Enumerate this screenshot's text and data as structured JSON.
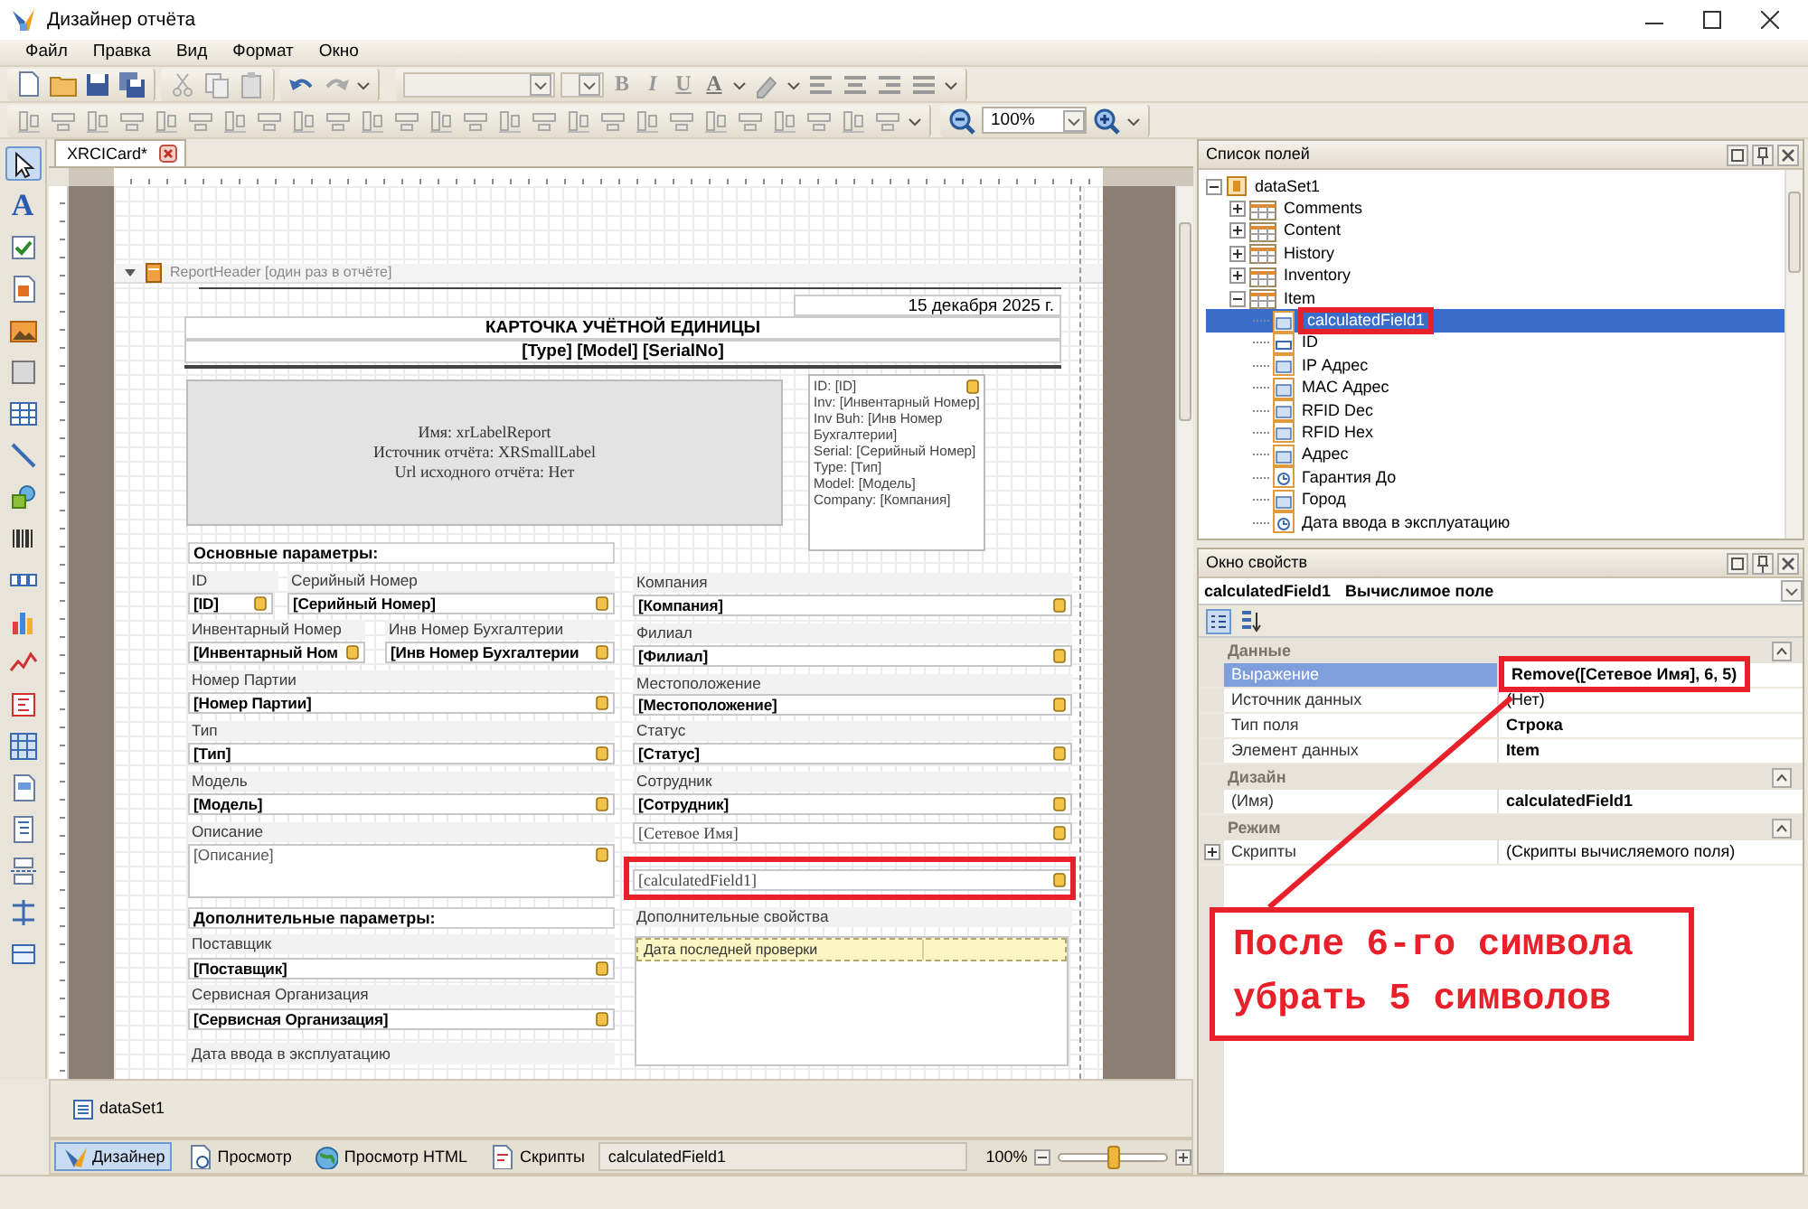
{
  "window": {
    "title": "Дизайнер отчёта"
  },
  "menu": [
    "Файл",
    "Правка",
    "Вид",
    "Формат",
    "Окно"
  ],
  "format_buttons": [
    "B",
    "I",
    "U",
    "A"
  ],
  "zoom_field": "100%",
  "toolbox": [
    {
      "kind": "pointer",
      "selected": true
    },
    {
      "kind": "label",
      "text": "A",
      "selected": false
    },
    {
      "kind": "checkbox",
      "selected": false
    },
    {
      "kind": "richtext",
      "selected": false
    },
    {
      "kind": "picture",
      "selected": false
    },
    {
      "kind": "panel",
      "selected": false
    },
    {
      "kind": "table",
      "selected": false
    },
    {
      "kind": "line",
      "selected": false
    },
    {
      "kind": "shape",
      "selected": false
    },
    {
      "kind": "barcode",
      "selected": false
    },
    {
      "kind": "zipcode",
      "selected": false
    },
    {
      "kind": "chart",
      "selected": false
    },
    {
      "kind": "sparkline",
      "selected": false
    },
    {
      "kind": "summary",
      "selected": false
    },
    {
      "kind": "pivot",
      "selected": false
    },
    {
      "kind": "subreport",
      "selected": false
    },
    {
      "kind": "contents",
      "selected": false
    },
    {
      "kind": "pagebreak",
      "selected": false
    },
    {
      "kind": "crossband",
      "selected": false
    },
    {
      "kind": "crossbox",
      "selected": false
    }
  ],
  "document_tab": {
    "label": "XRCICard*",
    "selected": true
  },
  "band": {
    "label": "ReportHeader [один раз в отчёте]",
    "expanded": true
  },
  "report": {
    "date": "15 декабря 2025 г.",
    "title": "КАРТОЧКА УЧЁТНОЙ ЕДИНИЦЫ",
    "subtitle": "[Type] [Model] [SerialNo]",
    "subreport": [
      "Имя: xrLabelReport",
      "Источник отчёта: XRSmallLabel",
      "Url исходного отчёта: Нет"
    ],
    "info_lines": [
      "ID: [ID]",
      "Inv: [Инвентарный Номер]",
      "Inv Buh: [Инв Номер",
      "Бухгалтерии]",
      "Serial: [Серийный Номер]",
      "Type: [Тип]",
      "Model: [Модель]",
      "Company: [Компания]"
    ],
    "controls": [
      {
        "kind": "section",
        "text": "Основные параметры:"
      },
      {
        "kind": "caption",
        "text": "ID"
      },
      {
        "kind": "caption",
        "text": "Серийный Номер"
      },
      {
        "kind": "field",
        "text": "[ID]"
      },
      {
        "kind": "field",
        "text": "[Серийный Номер]"
      },
      {
        "kind": "caption",
        "text": "Инвентарный Номер"
      },
      {
        "kind": "caption",
        "text": "Инв Номер Бухгалтерии"
      },
      {
        "kind": "field",
        "text": "[Инвентарный Ном"
      },
      {
        "kind": "field",
        "text": "[Инв Номер Бухгалтерии"
      },
      {
        "kind": "caption",
        "text": "Номер Партии"
      },
      {
        "kind": "field",
        "text": "[Номер Партии]"
      },
      {
        "kind": "caption",
        "text": "Тип"
      },
      {
        "kind": "field",
        "text": "[Тип]"
      },
      {
        "kind": "caption",
        "text": "Модель"
      },
      {
        "kind": "field",
        "text": "[Модель]"
      },
      {
        "kind": "caption",
        "text": "Описание"
      },
      {
        "kind": "memo",
        "text": "[Описание]"
      },
      {
        "kind": "section",
        "text": "Дополнительные параметры:"
      },
      {
        "kind": "caption",
        "text": "Поставщик"
      },
      {
        "kind": "field",
        "text": "[Поставщик]"
      },
      {
        "kind": "caption",
        "text": "Сервисная Организация"
      },
      {
        "kind": "field",
        "text": "[Сервисная Организация]"
      },
      {
        "kind": "caption",
        "text": "Дата ввода в эксплуатацию"
      },
      {
        "kind": "caption",
        "text": "Компания"
      },
      {
        "kind": "field",
        "text": "[Компания]"
      },
      {
        "kind": "caption",
        "text": "Филиал"
      },
      {
        "kind": "field",
        "text": "[Филиал]"
      },
      {
        "kind": "caption",
        "text": "Местоположение"
      },
      {
        "kind": "field",
        "text": "[Местоположение]"
      },
      {
        "kind": "caption",
        "text": "Статус"
      },
      {
        "kind": "field",
        "text": "[Статус]"
      },
      {
        "kind": "caption",
        "text": "Сотрудник"
      },
      {
        "kind": "field",
        "text": "[Сотрудник]"
      },
      {
        "kind": "plain",
        "text": "[Сетевое Имя]"
      },
      {
        "kind": "plain",
        "text": "[calculatedField1]",
        "annotated": true
      },
      {
        "kind": "caption",
        "text": "Дополнительные свойства"
      },
      {
        "kind": "table",
        "text": "Дата последней проверки"
      }
    ]
  },
  "component_tray": [
    "dataSet1"
  ],
  "view_tabs": [
    {
      "label": "Дизайнер",
      "selected": true
    },
    {
      "label": "Просмотр",
      "selected": false
    },
    {
      "label": "Просмотр HTML",
      "selected": false
    },
    {
      "label": "Скрипты",
      "selected": false
    }
  ],
  "status_field": "calculatedField1",
  "zoom": {
    "reading": "100%",
    "level": 0.5
  },
  "field_list": {
    "title": "Список полей",
    "tree": [
      {
        "label": "dataSet1",
        "kind": "dataset",
        "expanded": true,
        "selected": false,
        "children": [
          {
            "label": "Comments",
            "kind": "table",
            "expanded": false,
            "selected": false
          },
          {
            "label": "Content",
            "kind": "table",
            "expanded": false,
            "selected": false
          },
          {
            "label": "History",
            "kind": "table",
            "expanded": false,
            "selected": false
          },
          {
            "label": "Inventory",
            "kind": "table",
            "expanded": false,
            "selected": false
          },
          {
            "label": "Item",
            "kind": "table",
            "expanded": true,
            "selected": false,
            "children": [
              {
                "label": "calculatedField1",
                "kind": "text",
                "selected": true,
                "annotated": true
              },
              {
                "label": "ID",
                "kind": "number",
                "selected": false
              },
              {
                "label": "IP Адрес",
                "kind": "text",
                "selected": false
              },
              {
                "label": "MAC Адрес",
                "kind": "text",
                "selected": false
              },
              {
                "label": "RFID Dec",
                "kind": "text",
                "selected": false
              },
              {
                "label": "RFID Hex",
                "kind": "text",
                "selected": false
              },
              {
                "label": "Адрес",
                "kind": "text",
                "selected": false
              },
              {
                "label": "Гарантия До",
                "kind": "date",
                "selected": false
              },
              {
                "label": "Город",
                "kind": "text",
                "selected": false
              },
              {
                "label": "Дата ввода в эксплуатацию",
                "kind": "date",
                "selected": false
              }
            ]
          }
        ]
      }
    ]
  },
  "properties": {
    "title": "Окно свойств",
    "object": "calculatedField1",
    "object_type": "Вычислимое поле",
    "categories": [
      {
        "label": "Данные",
        "expanded": true,
        "rows": [
          {
            "name": "Выражение",
            "value": "Remove([Сетевое Имя], 6, 5)",
            "selected": true,
            "modified": true,
            "annotated": true
          },
          {
            "name": "Источник данных",
            "value": "(Нет)",
            "selected": false,
            "modified": false
          },
          {
            "name": "Тип поля",
            "value": "Строка",
            "selected": false,
            "modified": true
          },
          {
            "name": "Элемент данных",
            "value": "Item",
            "selected": false,
            "modified": true
          }
        ]
      },
      {
        "label": "Дизайн",
        "expanded": true,
        "rows": [
          {
            "name": "(Имя)",
            "value": "calculatedField1",
            "selected": false,
            "modified": true
          }
        ]
      },
      {
        "label": "Режим",
        "expanded": true,
        "rows": [
          {
            "name": "Скрипты",
            "value": "(Скрипты вычисляемого поля)",
            "selected": false,
            "modified": false,
            "expanded": false
          }
        ]
      }
    ]
  },
  "callout": {
    "text": "После 6-го символа убрать 5 символов"
  }
}
